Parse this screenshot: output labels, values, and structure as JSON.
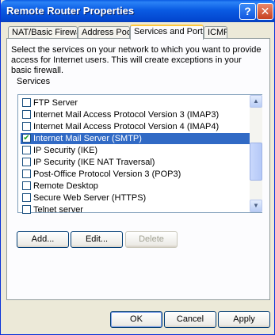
{
  "window": {
    "title": "Remote Router Properties"
  },
  "title_buttons": {
    "help": "?",
    "close": "✕"
  },
  "tabs": [
    {
      "label": "NAT/Basic Firewall",
      "active": false
    },
    {
      "label": "Address Pool",
      "active": false
    },
    {
      "label": "Services and Ports",
      "active": true
    },
    {
      "label": "ICMP",
      "active": false
    }
  ],
  "description": "Select the services on your network to which you want to provide access for Internet users. This will create exceptions in your basic firewall.",
  "services_label": "Services",
  "services": [
    {
      "label": "FTP Server",
      "checked": false,
      "selected": false
    },
    {
      "label": "Internet Mail Access Protocol Version 3 (IMAP3)",
      "checked": false,
      "selected": false
    },
    {
      "label": "Internet Mail Access Protocol Version 4 (IMAP4)",
      "checked": false,
      "selected": false
    },
    {
      "label": "Internet Mail Server (SMTP)",
      "checked": true,
      "selected": true
    },
    {
      "label": "IP Security (IKE)",
      "checked": false,
      "selected": false
    },
    {
      "label": "IP Security (IKE NAT Traversal)",
      "checked": false,
      "selected": false
    },
    {
      "label": "Post-Office Protocol Version 3 (POP3)",
      "checked": false,
      "selected": false
    },
    {
      "label": "Remote Desktop",
      "checked": false,
      "selected": false
    },
    {
      "label": "Secure Web Server (HTTPS)",
      "checked": false,
      "selected": false
    },
    {
      "label": "Telnet server",
      "checked": false,
      "selected": false
    }
  ],
  "list_buttons": {
    "add": "Add...",
    "edit": "Edit...",
    "delete": "Delete"
  },
  "dialog_buttons": {
    "ok": "OK",
    "cancel": "Cancel",
    "apply": "Apply"
  },
  "colors": {
    "title_bar": "#0A5BE3",
    "selection": "#316AC5",
    "dialog_bg": "#ECE9D8"
  }
}
